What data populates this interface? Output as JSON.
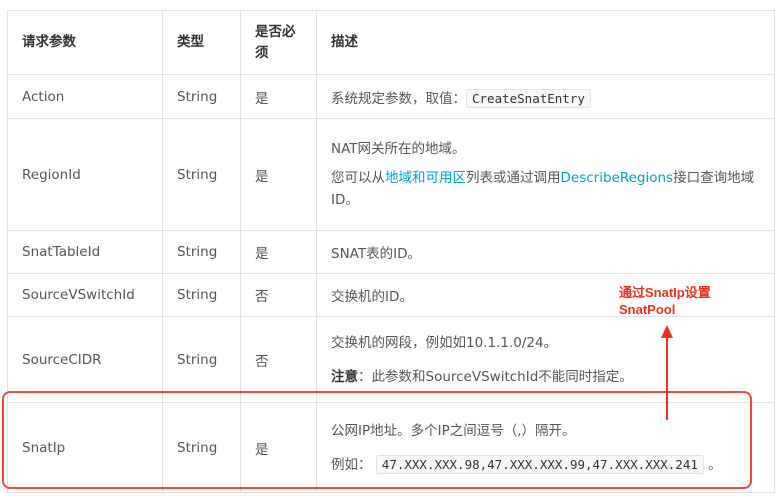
{
  "headers": {
    "name": "请求参数",
    "type": "类型",
    "required": "是否必须",
    "desc": "描述"
  },
  "rows": {
    "action": {
      "name": "Action",
      "type": "String",
      "required": "是",
      "desc": "系统规定参数，取值：",
      "code": "CreateSnatEntry"
    },
    "region": {
      "name": "RegionId",
      "type": "String",
      "required": "是",
      "desc1": "NAT网关所在的地域。",
      "desc2_pre": "您可以从",
      "link1": "地域和可用区",
      "desc2_mid": "列表或通过调用",
      "link2": "DescribeRegions",
      "desc2_post": "接口查询地域ID。"
    },
    "snattable": {
      "name": "SnatTableId",
      "type": "String",
      "required": "是",
      "desc": "SNAT表的ID。"
    },
    "vswitch": {
      "name": "SourceVSwitchId",
      "type": "String",
      "required": "否",
      "desc": "交换机的ID。"
    },
    "cidr": {
      "name": "SourceCIDR",
      "type": "String",
      "required": "否",
      "desc1": "交换机的网段，例如如10.1.1.0/24。",
      "note_label": "注意",
      "note_text": "：此参数和SourceVSwitchId不能同时指定。"
    },
    "snatip": {
      "name": "SnatIp",
      "type": "String",
      "required": "是",
      "desc1": "公网IP地址。多个IP之间逗号（,）隔开。",
      "example_pre": "例如：",
      "example_code": "47.XXX.XXX.98,47.XXX.XXX.99,47.XXX.XXX.241",
      "example_post": "。"
    }
  },
  "annotation": {
    "line1": "通过SnatIp设置",
    "line2": "SnatPool"
  },
  "colors": {
    "annotation": "#f0301e",
    "link": "#00a1d6"
  }
}
